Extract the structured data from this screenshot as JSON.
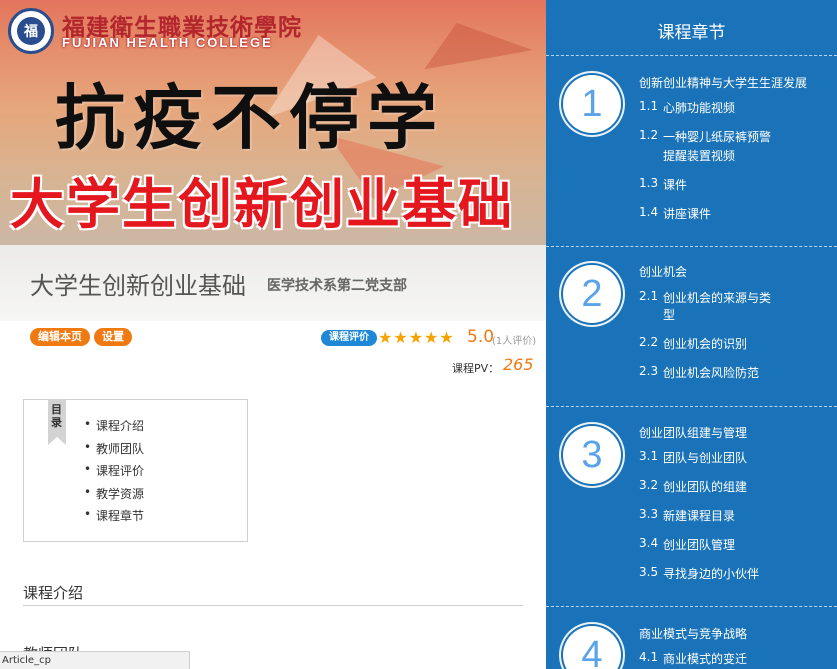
{
  "banner": {
    "school_cn": "福建衛生職業技術學院",
    "school_en": "FUJIAN HEALTH COLLEGE",
    "line1": "抗疫不停学",
    "line2": "大学生创新创业基础"
  },
  "course": {
    "title": "大学生创新创业基础",
    "department": "医学技术系第二党支部"
  },
  "actions": {
    "edit_label": "编辑本页",
    "settings_label": "设置"
  },
  "rating": {
    "badge_label": "课程评价",
    "stars": "★★★★★",
    "score": "5.0",
    "count": "(1人评价)",
    "pv_label": "课程PV：",
    "pv_value": "265"
  },
  "toc": {
    "tag": "目录",
    "items": [
      "课程介绍",
      "教师团队",
      "课程评价",
      "教学资源",
      "课程章节"
    ]
  },
  "sections": {
    "intro_heading": "课程介绍",
    "team_heading": "教师团队"
  },
  "status_bar": "Article_cp",
  "sidebar": {
    "header": "课程章节",
    "chapters": [
      {
        "number": "1",
        "title": "创新创业精神与大学生生涯发展",
        "lessons": [
          {
            "num": "1.1",
            "label": "心肺功能视频"
          },
          {
            "num": "1.2",
            "label": "一种婴儿纸尿裤预警",
            "label2": "提醒装置视频"
          },
          {
            "num": "1.3",
            "label": "课件"
          },
          {
            "num": "1.4",
            "label": "讲座课件"
          }
        ]
      },
      {
        "number": "2",
        "title": "创业机会",
        "lessons": [
          {
            "num": "2.1",
            "label": "创业机会的来源与类",
            "label2": "型"
          },
          {
            "num": "2.2",
            "label": "创业机会的识别"
          },
          {
            "num": "2.3",
            "label": "创业机会风险防范"
          }
        ]
      },
      {
        "number": "3",
        "title": "创业团队组建与管理",
        "lessons": [
          {
            "num": "3.1",
            "label": "团队与创业团队"
          },
          {
            "num": "3.2",
            "label": "创业团队的组建"
          },
          {
            "num": "3.3",
            "label": "新建课程目录"
          },
          {
            "num": "3.4",
            "label": "创业团队管理"
          },
          {
            "num": "3.5",
            "label": "寻找身边的小伙伴"
          }
        ]
      },
      {
        "number": "4",
        "title": "商业模式与竞争战略",
        "lessons": [
          {
            "num": "4.1",
            "label": "商业模式的变迁"
          }
        ]
      }
    ]
  }
}
